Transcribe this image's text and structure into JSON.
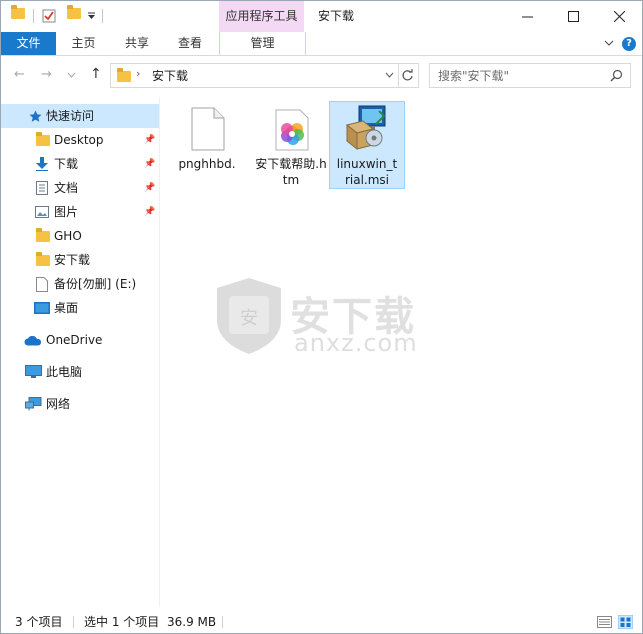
{
  "title_bar": {
    "context_tab": "应用程序工具",
    "window_title": "安下载"
  },
  "ribbon": {
    "tabs": [
      "文件",
      "主页",
      "共享",
      "查看",
      "管理"
    ]
  },
  "address": {
    "path": "安下载",
    "search_placeholder": "搜索\"安下载\""
  },
  "nav": {
    "quick_access": "快速访问",
    "items": [
      {
        "label": "Desktop",
        "pinned": true,
        "icon": "folder-icon"
      },
      {
        "label": "下载",
        "pinned": true,
        "icon": "download-icon"
      },
      {
        "label": "文档",
        "pinned": true,
        "icon": "document-icon"
      },
      {
        "label": "图片",
        "pinned": true,
        "icon": "pictures-icon"
      },
      {
        "label": "GHO",
        "pinned": false,
        "icon": "folder-icon"
      },
      {
        "label": "安下载",
        "pinned": false,
        "icon": "folder-icon"
      },
      {
        "label": "备份[勿删] (E:)",
        "pinned": false,
        "icon": "drive-icon"
      },
      {
        "label": "桌面",
        "pinned": false,
        "icon": "desktop-icon"
      }
    ],
    "onedrive": "OneDrive",
    "this_pc": "此电脑",
    "network": "网络"
  },
  "files": [
    {
      "name": "pnghhbd.",
      "icon": "blank-file-icon",
      "selected": false
    },
    {
      "name": "安下载帮助.htm",
      "icon": "html-file-icon",
      "selected": false
    },
    {
      "name": "linuxwin_trial.msi",
      "icon": "msi-installer-icon",
      "selected": true
    }
  ],
  "watermark": {
    "shield_char": "安",
    "big": "安下载",
    "small": "anxz.com"
  },
  "status": {
    "count": "3 个项目",
    "selected": "选中 1 个项目",
    "size": "36.9 MB"
  },
  "colors": {
    "file_tab": "#1979ca",
    "context_tab": "#f3d9f4",
    "selection": "#cce8ff",
    "folder": "#f5c244"
  }
}
